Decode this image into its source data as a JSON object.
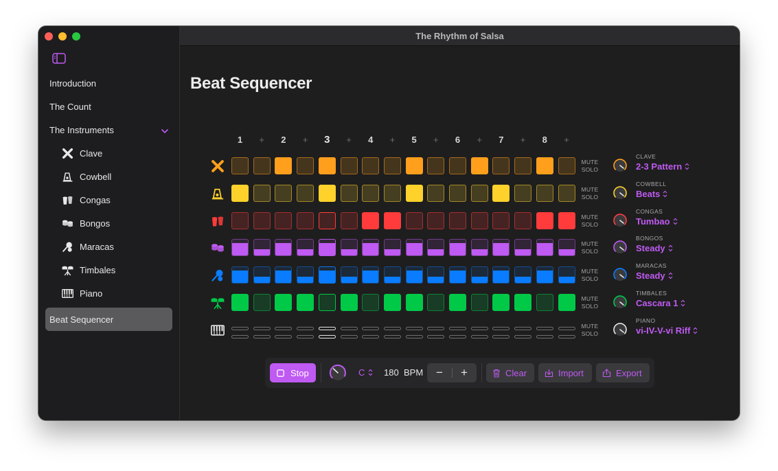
{
  "window": {
    "title": "The Rhythm of Salsa"
  },
  "sidebar": {
    "items": [
      {
        "label": "Introduction",
        "level": 0
      },
      {
        "label": "The Count",
        "level": 0
      },
      {
        "label": "The Instruments",
        "level": 0,
        "expanded": true
      },
      {
        "label": "Clave",
        "level": 1,
        "icon": "clave-icon"
      },
      {
        "label": "Cowbell",
        "level": 1,
        "icon": "cowbell-icon"
      },
      {
        "label": "Congas",
        "level": 1,
        "icon": "congas-icon"
      },
      {
        "label": "Bongos",
        "level": 1,
        "icon": "bongos-icon"
      },
      {
        "label": "Maracas",
        "level": 1,
        "icon": "maracas-icon"
      },
      {
        "label": "Timbales",
        "level": 1,
        "icon": "timbales-icon"
      },
      {
        "label": "Piano",
        "level": 1,
        "icon": "piano-icon"
      },
      {
        "label": "Beat Sequencer",
        "level": 0,
        "selected": true
      }
    ]
  },
  "main": {
    "title": "Beat Sequencer"
  },
  "sequencer": {
    "beats": [
      "1",
      "+",
      "2",
      "+",
      "3",
      "+",
      "4",
      "+",
      "5",
      "+",
      "6",
      "+",
      "7",
      "+",
      "8",
      "+"
    ],
    "current_step": 4,
    "mute_label": "MUTE",
    "solo_label": "SOLO",
    "tracks": [
      {
        "name": "CLAVE",
        "pattern": "2-3 Pattern",
        "color": "#ff9f1c",
        "icon": "clave-icon",
        "style": "block",
        "steps": [
          0,
          0,
          1,
          0,
          1,
          0,
          0,
          0,
          1,
          0,
          0,
          1,
          0,
          0,
          1,
          0
        ]
      },
      {
        "name": "COWBELL",
        "pattern": "Beats",
        "color": "#ffd12b",
        "icon": "cowbell-icon",
        "style": "block",
        "steps": [
          1,
          0,
          0,
          0,
          1,
          0,
          0,
          0,
          1,
          0,
          0,
          0,
          1,
          0,
          0,
          0
        ]
      },
      {
        "name": "CONGAS",
        "pattern": "Tumbao",
        "color": "#ff3b3b",
        "icon": "congas-icon",
        "style": "block",
        "steps": [
          0,
          0,
          0,
          0,
          0,
          0,
          1,
          1,
          0,
          0,
          0,
          0,
          0,
          0,
          1,
          1
        ]
      },
      {
        "name": "BONGOS",
        "pattern": "Steady",
        "color": "#bf5af2",
        "icon": "bongos-icon",
        "style": "level",
        "steps": [
          1,
          0.4,
          1,
          0.4,
          1,
          0.4,
          1,
          0.4,
          1,
          0.4,
          1,
          0.4,
          1,
          0.4,
          1,
          0.4
        ]
      },
      {
        "name": "MARACAS",
        "pattern": "Steady",
        "color": "#0a7cff",
        "icon": "maracas-icon",
        "style": "level",
        "steps": [
          1,
          0.4,
          1,
          0.4,
          1,
          0.4,
          1,
          0.4,
          1,
          0.4,
          1,
          0.4,
          1,
          0.4,
          1,
          0.4
        ]
      },
      {
        "name": "TIMBALES",
        "pattern": "Cascara 1",
        "color": "#00c948",
        "icon": "timbales-icon",
        "style": "block",
        "steps": [
          1,
          0,
          1,
          1,
          0,
          1,
          0,
          1,
          1,
          0,
          1,
          0,
          1,
          1,
          0,
          1
        ]
      },
      {
        "name": "PIANO",
        "pattern": "vi-IV-V-vi Riff",
        "color": "#e6e6e6",
        "icon": "piano-icon",
        "style": "piano",
        "steps": [
          0,
          0,
          0,
          0,
          0,
          0,
          0,
          0,
          0,
          0,
          0,
          0,
          0,
          0,
          0,
          0
        ]
      }
    ]
  },
  "transport": {
    "stop_label": "Stop",
    "key": "C",
    "bpm": "180",
    "bpm_unit": "BPM",
    "decrement": "−",
    "increment": "+",
    "clear_label": "Clear",
    "import_label": "Import",
    "export_label": "Export",
    "accent": "#bf5af2"
  }
}
